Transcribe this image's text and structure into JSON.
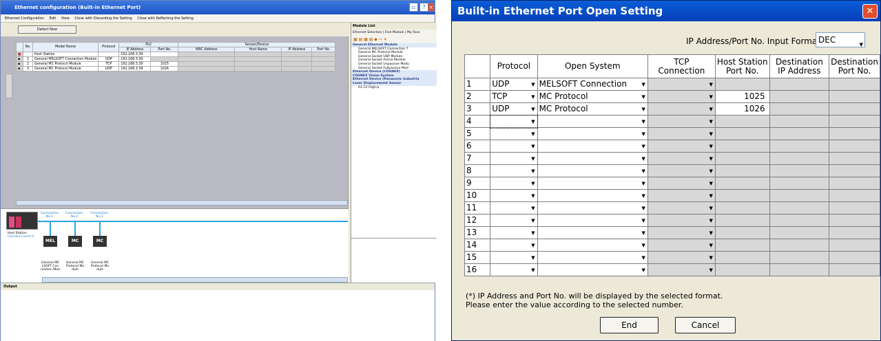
{
  "left_window": {
    "title": "Ethernet configuration (Built-in Ethernet Port)",
    "menu": [
      "Ethernet Configuration",
      "Edit",
      "View",
      "Close with Discarding the Setting",
      "Close with Reflecting the Setting"
    ],
    "detect_now": "Detect Now",
    "table": {
      "headers": {
        "no": "No.",
        "model": "Model Name",
        "protocol": "Protocol",
        "plc": "PLC",
        "sensor": "Sensor/Device",
        "ip": "IP Address",
        "port": "Port No.",
        "mac": "MAC Address",
        "host": "Host Name",
        "sip": "IP Address",
        "sport": "Port No."
      },
      "rows": [
        {
          "no": "",
          "model": "Host Station",
          "protocol": "",
          "ip": "192.168.3.39",
          "port": ""
        },
        {
          "no": "1",
          "model": "General MELSOFT Connection Module",
          "protocol": "UDP",
          "ip": "192.168.3.39",
          "port": ""
        },
        {
          "no": "2",
          "model": "General MC Protocol Module",
          "protocol": "TCP",
          "ip": "192.168.3.39",
          "port": "1025"
        },
        {
          "no": "3",
          "model": "General MC Protocol Module",
          "protocol": "UDP",
          "ip": "192.168.3.39",
          "port": "1026"
        }
      ]
    },
    "diagram": {
      "host_label": "Host Station",
      "connect_count": "Connect Count:3",
      "connections": [
        "Connection\nNo.1",
        "Connection\nNo.2",
        "Connection\nNo.3"
      ],
      "modules": [
        {
          "icon": "MEL",
          "label": "General ME\nLSOFT Con\nnection Mod"
        },
        {
          "icon": "MC",
          "label": "General MC\nProtocol Mo\ndule"
        },
        {
          "icon": "MC",
          "label": "General MC\nProtocol Mo\ndule"
        }
      ]
    },
    "module_list": {
      "title": "Module List",
      "tabs": "Ethernet Selection | Find Module | My Favo",
      "tree": [
        {
          "type": "cat",
          "text": "General Ethernet Module"
        },
        {
          "type": "sub",
          "text": "General MELSOFT Connection T"
        },
        {
          "type": "sub",
          "text": "General MC Protocol Module"
        },
        {
          "type": "sub",
          "text": "General Socket UDP Module"
        },
        {
          "type": "sub",
          "text": "General Socket Active Module"
        },
        {
          "type": "sub",
          "text": "General Socket Unpassive Modu"
        },
        {
          "type": "sub",
          "text": "General Socket Fullpassive Mod"
        },
        {
          "type": "cat",
          "text": "Ethernet Device (COGNEX)"
        },
        {
          "type": "cat",
          "text": "COGNEX Vision System"
        },
        {
          "type": "cat",
          "text": "Ethernet Device (Panasonic Industria"
        },
        {
          "type": "cat",
          "text": "Laser Displacement Sensor"
        },
        {
          "type": "sub",
          "text": "HL-C2                              High-p"
        }
      ]
    },
    "output_title": "Output"
  },
  "dialog": {
    "title": "Built-in Ethernet Port Open Setting",
    "format_label": "IP Address/Port No. Input Format",
    "format_value": "DEC",
    "headers": {
      "protocol": "Protocol",
      "open_system": "Open System",
      "tcp_connection": "TCP Connection",
      "host_port": "Host Station\nPort No.",
      "dest_ip": "Destination\nIP Address",
      "dest_port": "Destination\nPort No."
    },
    "rows": [
      {
        "n": "1",
        "protocol": "UDP",
        "open": "MELSOFT Connection",
        "port": ""
      },
      {
        "n": "2",
        "protocol": "TCP",
        "open": "MC Protocol",
        "port": "1025"
      },
      {
        "n": "3",
        "protocol": "UDP",
        "open": "MC Protocol",
        "port": "1026"
      },
      {
        "n": "4",
        "protocol": "",
        "open": "",
        "port": ""
      },
      {
        "n": "5",
        "protocol": "",
        "open": "",
        "port": ""
      },
      {
        "n": "6",
        "protocol": "",
        "open": "",
        "port": ""
      },
      {
        "n": "7",
        "protocol": "",
        "open": "",
        "port": ""
      },
      {
        "n": "8",
        "protocol": "",
        "open": "",
        "port": ""
      },
      {
        "n": "9",
        "protocol": "",
        "open": "",
        "port": ""
      },
      {
        "n": "10",
        "protocol": "",
        "open": "",
        "port": ""
      },
      {
        "n": "11",
        "protocol": "",
        "open": "",
        "port": ""
      },
      {
        "n": "12",
        "protocol": "",
        "open": "",
        "port": ""
      },
      {
        "n": "13",
        "protocol": "",
        "open": "",
        "port": ""
      },
      {
        "n": "14",
        "protocol": "",
        "open": "",
        "port": ""
      },
      {
        "n": "15",
        "protocol": "",
        "open": "",
        "port": ""
      },
      {
        "n": "16",
        "protocol": "",
        "open": "",
        "port": ""
      }
    ],
    "note_line1": "(*) IP Address and Port No. will be displayed by the selected format.",
    "note_line2": "Please enter the value according to the selected number.",
    "end_label": "End",
    "cancel_label": "Cancel",
    "close_glyph": "✕"
  }
}
